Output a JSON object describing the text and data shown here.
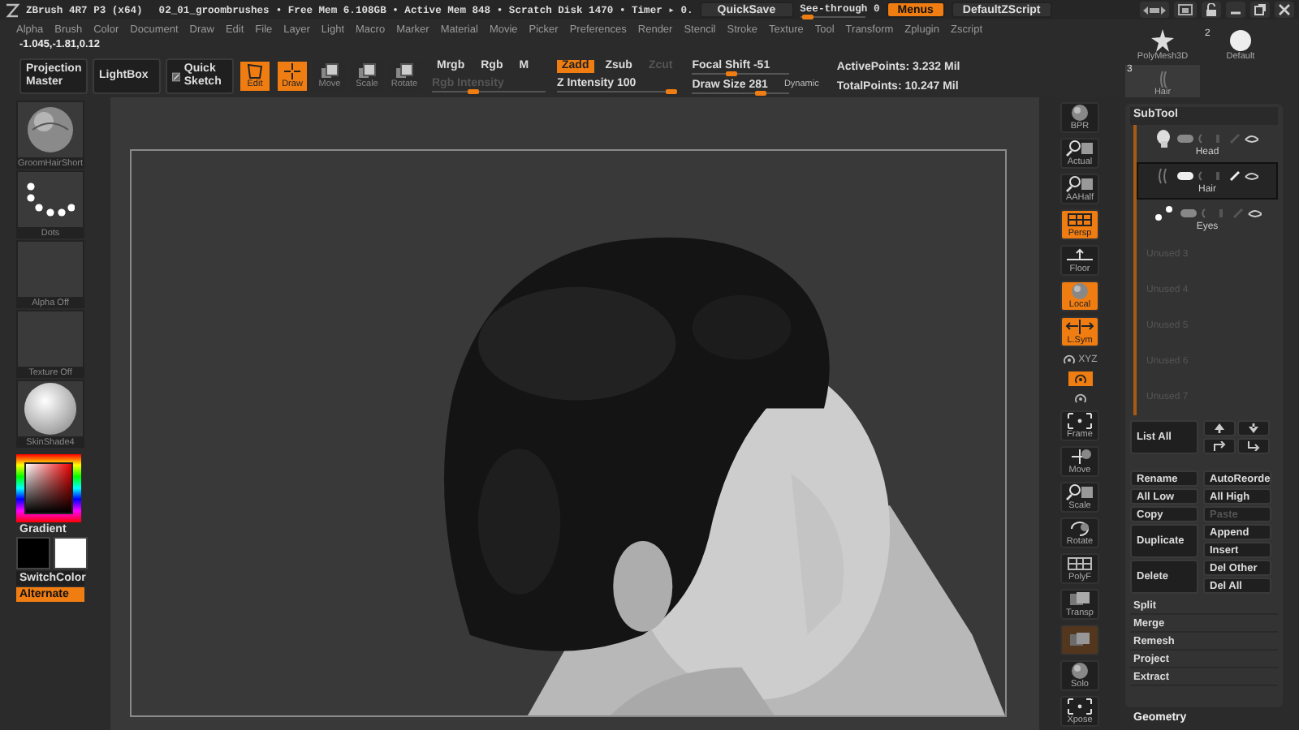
{
  "title_bar": {
    "app": "ZBrush 4R7 P3 (x64)",
    "document": "02_01_groombrushes",
    "stats": "• Free Mem 6.108GB • Active Mem 848 • Scratch Disk 1470 • Timer ▸ 0.",
    "quick_save": "QuickSave",
    "see_through": {
      "label": "See-through  0",
      "level": 0.1
    },
    "menus": {
      "label": "Menus",
      "selected": true
    },
    "script": "DefaultZScript"
  },
  "menu": [
    "Alpha",
    "Brush",
    "Color",
    "Document",
    "Draw",
    "Edit",
    "File",
    "Layer",
    "Light",
    "Macro",
    "Marker",
    "Material",
    "Movie",
    "Picker",
    "Preferences",
    "Render",
    "Stencil",
    "Stroke",
    "Texture",
    "Tool",
    "Transform",
    "Zplugin",
    "Zscript"
  ],
  "coordinates": "-1.045,-1.81,0.12",
  "top_shelf": {
    "projection_master": "Projection Master",
    "lightbox": "LightBox",
    "quick_sketch": "Quick Sketch",
    "modes": [
      {
        "label": "Edit",
        "selected": true
      },
      {
        "label": "Draw",
        "selected": true
      },
      {
        "label": "Move",
        "selected": false
      },
      {
        "label": "Scale",
        "selected": false
      },
      {
        "label": "Rotate",
        "selected": false
      }
    ],
    "channels": [
      {
        "label": "Mrgb",
        "selected": false
      },
      {
        "label": "Rgb",
        "selected": false
      },
      {
        "label": "M",
        "selected": false
      }
    ],
    "rgb_intensity": {
      "label": "Rgb Intensity",
      "level": 0.35
    },
    "z_modes": [
      {
        "label": "Zadd",
        "selected": true,
        "disabled": false
      },
      {
        "label": "Zsub",
        "selected": false,
        "disabled": false
      },
      {
        "label": "Zcut",
        "selected": false,
        "disabled": true
      }
    ],
    "z_intensity": {
      "label": "Z Intensity 100",
      "level": 1
    },
    "focal_shift": {
      "label": "Focal Shift -51",
      "level": 0.4
    },
    "draw_size": {
      "label": "Draw Size 281",
      "level": 0.7
    },
    "dynamic": "Dynamic",
    "active_points": "ActivePoints: 3.232 Mil",
    "total_points": "TotalPoints: 10.247 Mil"
  },
  "tool_palette": [
    {
      "label": "PolyMesh3D",
      "kind": "star",
      "selected": false
    },
    {
      "number": "2",
      "label": "Default",
      "kind": "sphere",
      "selected": false
    },
    {
      "number": "3",
      "label": "Hair",
      "kind": "hair",
      "selected": true
    }
  ],
  "left_shelf": {
    "thumbs": [
      {
        "label": "GroomHairShort",
        "kind": "brush"
      },
      {
        "label": "Dots",
        "kind": "stroke"
      },
      {
        "label": "Alpha Off",
        "kind": "empty"
      },
      {
        "label": "Texture Off",
        "kind": "empty"
      },
      {
        "label": "SkinShade4",
        "kind": "material"
      }
    ],
    "gradient": "Gradient",
    "switch_color": "SwitchColor",
    "alternate": {
      "label": "Alternate",
      "selected": true
    }
  },
  "right_shelf": [
    {
      "kind": "big",
      "label": "BPR",
      "on": false
    },
    {
      "kind": "big",
      "label": "Actual",
      "on": false
    },
    {
      "kind": "big",
      "label": "AAHalf",
      "on": false
    },
    {
      "kind": "big",
      "label": "Persp",
      "on": true
    },
    {
      "kind": "big",
      "label": "Floor",
      "on": false
    },
    {
      "kind": "big",
      "label": "Local",
      "on": true
    },
    {
      "kind": "big",
      "label": "L.Sym",
      "on": true
    },
    {
      "kind": "small",
      "label": "XYZ",
      "on": false
    },
    {
      "kind": "small",
      "on": true
    },
    {
      "kind": "small",
      "on": false
    },
    {
      "kind": "big",
      "label": "Frame",
      "on": false
    },
    {
      "kind": "big",
      "label": "Move",
      "on": false
    },
    {
      "kind": "big",
      "label": "Scale",
      "on": false
    },
    {
      "kind": "big",
      "label": "Rotate",
      "on": false
    },
    {
      "kind": "big",
      "label": "PolyF",
      "on": false
    },
    {
      "kind": "big",
      "label": "Transp",
      "on": false
    },
    {
      "kind": "big",
      "on": true,
      "dimmed": true
    },
    {
      "kind": "big",
      "label": "Solo",
      "on": false
    },
    {
      "kind": "big",
      "label": "Xpose",
      "on": false
    }
  ],
  "subtool": {
    "title": "SubTool",
    "items": [
      {
        "name": "Head",
        "kind": "head",
        "selected": false
      },
      {
        "name": "Hair",
        "kind": "hair",
        "selected": true
      },
      {
        "name": "Eyes",
        "kind": "eyes",
        "selected": false
      }
    ],
    "unused": [
      "Unused 3",
      "Unused 4",
      "Unused 5",
      "Unused 6",
      "Unused 7"
    ],
    "list_all": "List All",
    "actions": [
      {
        "left": {
          "label": "Rename",
          "disabled": false
        },
        "right": [
          {
            "label": "AutoReorde",
            "disabled": false
          }
        ]
      },
      {
        "left": {
          "label": "All Low",
          "disabled": false
        },
        "right": [
          {
            "label": "All High",
            "disabled": false
          }
        ]
      },
      {
        "left": {
          "label": "Copy",
          "disabled": false
        },
        "right": [
          {
            "label": "Paste",
            "disabled": true
          }
        ]
      },
      {
        "left": {
          "label": "Duplicate",
          "disabled": false
        },
        "right": [
          {
            "label": "Append",
            "disabled": false
          },
          {
            "label": "Insert",
            "disabled": false
          }
        ]
      },
      {
        "left": {
          "label": "Delete",
          "disabled": false
        },
        "right": [
          {
            "label": "Del Other",
            "disabled": false
          },
          {
            "label": "Del All",
            "disabled": false
          }
        ]
      }
    ],
    "tools": [
      "Split",
      "Merge",
      "Remesh",
      "Project",
      "Extract"
    ],
    "geometry": "Geometry"
  }
}
